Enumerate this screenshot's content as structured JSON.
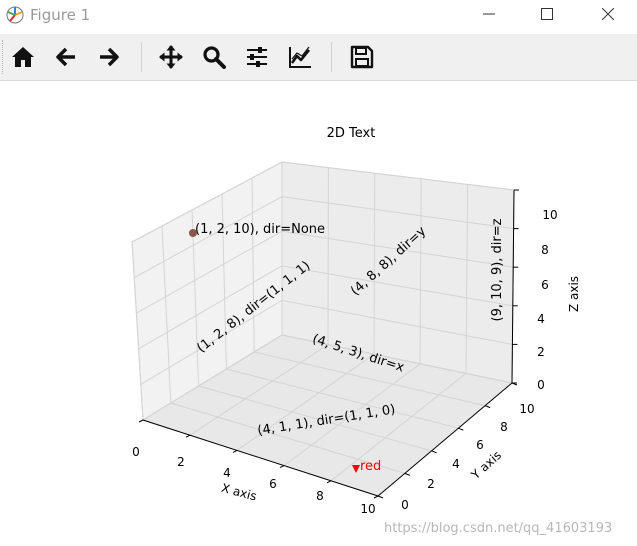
{
  "window": {
    "title": "Figure 1"
  },
  "toolbar": {
    "tools": [
      {
        "name": "home-icon"
      },
      {
        "name": "back-icon"
      },
      {
        "name": "forward-icon"
      },
      {
        "name": "pan-icon"
      },
      {
        "name": "zoom-icon"
      },
      {
        "name": "configure-subplots-icon"
      },
      {
        "name": "edit-axis-icon"
      },
      {
        "name": "save-icon"
      }
    ]
  },
  "chart_data": {
    "type": "scatter",
    "title": "2D Text",
    "xlabel": "X axis",
    "ylabel": "Y axis",
    "zlabel": "Z axis",
    "xlim": [
      0,
      10
    ],
    "ylim": [
      0,
      10
    ],
    "zlim": [
      0,
      10
    ],
    "grid": true,
    "x_ticks": [
      "0",
      "2",
      "4",
      "6",
      "8",
      "10"
    ],
    "y_ticks": [
      "0",
      "2",
      "4",
      "6",
      "8",
      "10"
    ],
    "z_ticks": [
      "0",
      "2",
      "4",
      "6",
      "8",
      "10"
    ],
    "annotations": [
      {
        "text": "(1, 2, 10), dir=None",
        "x": 1,
        "y": 2,
        "z": 10
      },
      {
        "text": "(1, 2, 8), dir=(1, 1, 1)",
        "x": 1,
        "y": 2,
        "z": 8
      },
      {
        "text": "(4, 8, 8), dir=y",
        "x": 4,
        "y": 8,
        "z": 8
      },
      {
        "text": "(9, 10, 9), dir=z",
        "x": 9,
        "y": 10,
        "z": 9
      },
      {
        "text": "(4, 5, 3), dir=x",
        "x": 4,
        "y": 5,
        "z": 3
      },
      {
        "text": "(4, 1, 1), dir=(1, 1, 0)",
        "x": 4,
        "y": 1,
        "z": 1
      },
      {
        "text": "red",
        "color": "#ff0000"
      }
    ],
    "points": [
      {
        "x": 1,
        "y": 2,
        "z": 10,
        "marker": "circle",
        "color": "#8c564b"
      },
      {
        "x": 10,
        "y": 0,
        "z": 0,
        "marker": "triangle-down",
        "color": "#ff0000"
      }
    ]
  },
  "watermark": "https://blog.csdn.net/qq_41603193",
  "colors": {
    "toolbar_bg": "#f0f0f0",
    "pane_bg": "#f2f2f2",
    "text_red": "#ff0000"
  }
}
